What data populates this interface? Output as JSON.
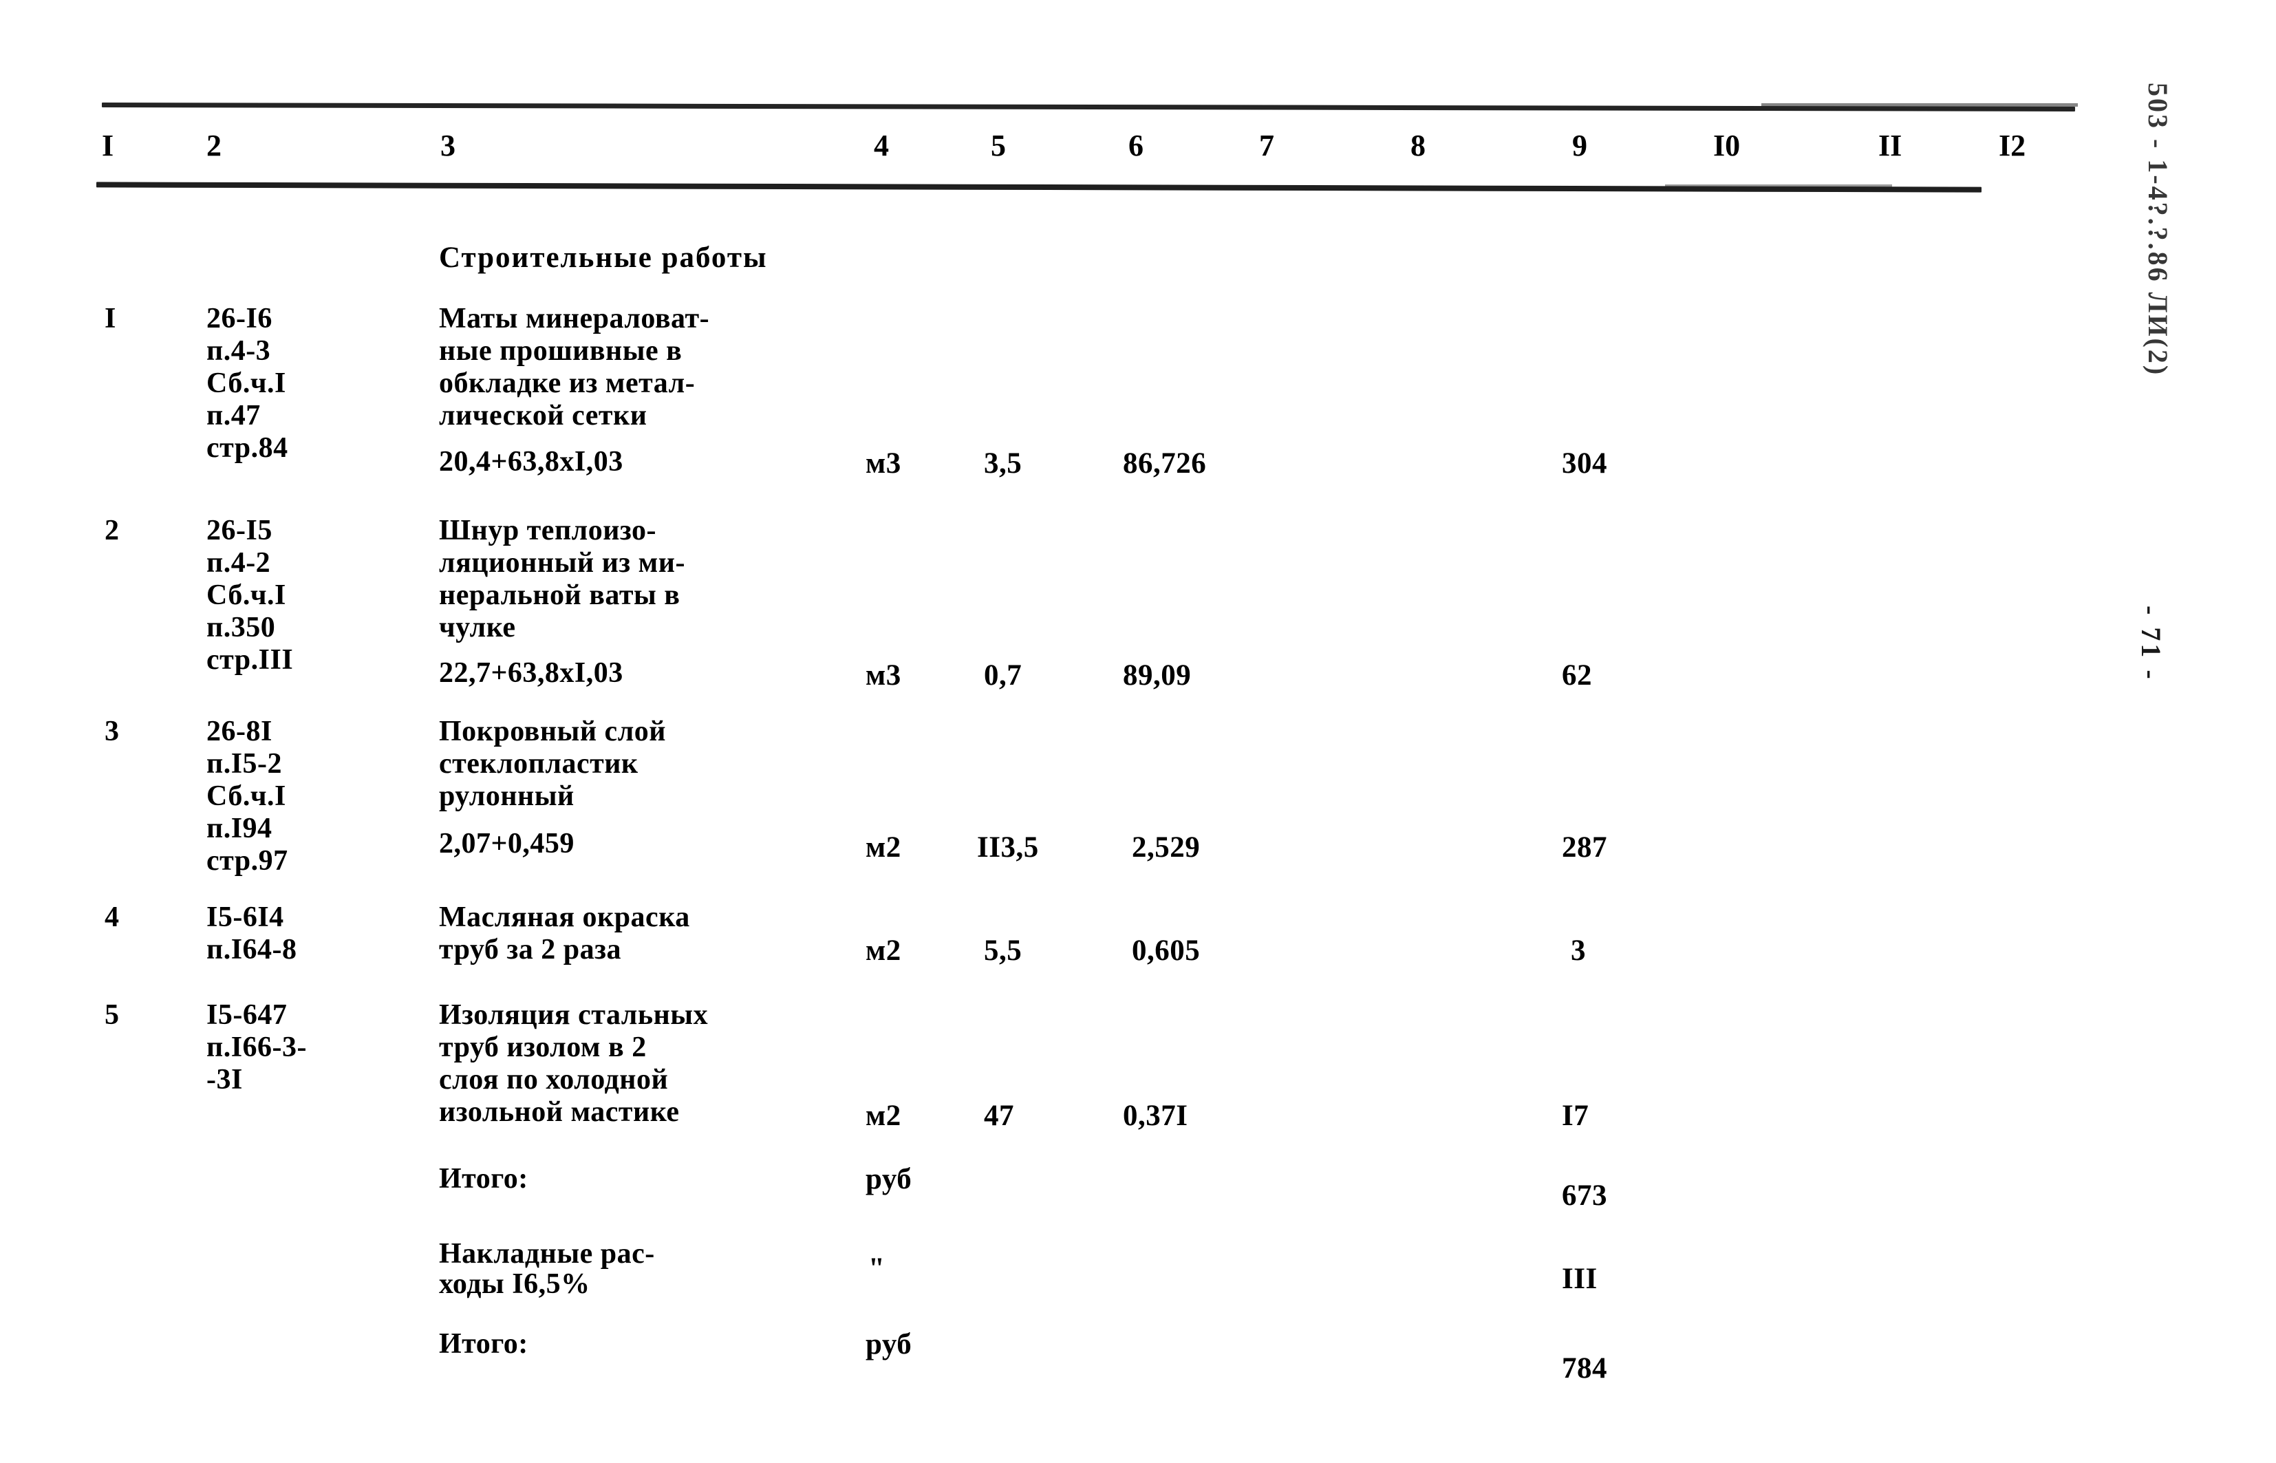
{
  "document": {
    "margin_stamp_code": "503 - 1-4?.?.86  ЛИ(2)",
    "margin_stamp_page": "- 71 -",
    "section_title": "Строительные работы"
  },
  "table": {
    "column_headers": [
      "I",
      "2",
      "3",
      "4",
      "5",
      "6",
      "7",
      "8",
      "9",
      "I0",
      "II",
      "I2"
    ],
    "rows": [
      {
        "no": "I",
        "code": "26-I6\nп.4-3\nСб.ч.I\nп.47\nстр.84",
        "description": "Маты минераловат-\nные прошивные в\nобкладке из метал-\nлической сетки",
        "formula": "20,4+63,8xI,03",
        "unit": "м3",
        "qty": "3,5",
        "price": "86,726",
        "total": "304"
      },
      {
        "no": "2",
        "code": "26-I5\nп.4-2\nСб.ч.I\nп.350\nстр.III",
        "description": "Шнур теплоизо-\nляционный из ми-\nнеральной ваты в\nчулке",
        "formula": "22,7+63,8xI,03",
        "unit": "м3",
        "qty": "0,7",
        "price": "89,09",
        "total": "62"
      },
      {
        "no": "3",
        "code": "26-8I\nп.I5-2\nСб.ч.I\nп.I94\nстр.97",
        "description": "Покровный слой\nстеклопластик\nрулонный",
        "formula": "2,07+0,459",
        "unit": "м2",
        "qty": "II3,5",
        "price": "2,529",
        "total": "287"
      },
      {
        "no": "4",
        "code": "I5-6I4\nп.I64-8",
        "description": "Масляная окраска\nтруб за 2 раза",
        "formula": "",
        "unit": "м2",
        "qty": "5,5",
        "price": "0,605",
        "total": "3"
      },
      {
        "no": "5",
        "code": "I5-647\nп.I66-3-\n-3I",
        "description": "Изоляция стальных\nтруб изолом в 2\nслоя по холодной\nизольной мастике",
        "formula": "",
        "unit": "м2",
        "qty": "47",
        "price": "0,37I",
        "total": "I7"
      }
    ],
    "summary_rows": [
      {
        "label": "Итого:",
        "unit": "руб",
        "total": "673"
      },
      {
        "label": "Накладные рас-\nходы I6,5%",
        "unit": "\"",
        "total": "III"
      },
      {
        "label": "Итого:",
        "unit": "руб",
        "total": "784"
      }
    ]
  }
}
